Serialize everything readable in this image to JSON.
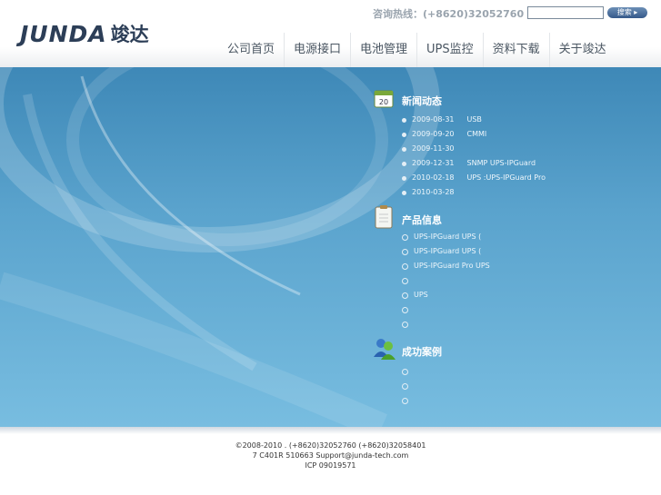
{
  "header": {
    "logo_en": "JUNDA",
    "logo_cn": "竣达",
    "hotline": "咨询热线：(+8620)32052760",
    "search_value": "",
    "search_button": "搜索 ▸"
  },
  "nav": [
    "公司首页",
    "电源接口",
    "电池管理",
    "UPS监控",
    "资料下载",
    "关于竣达"
  ],
  "news": {
    "title": "新闻动态",
    "icon_text": "20",
    "items": [
      {
        "date": "2009-08-31",
        "text": "USB"
      },
      {
        "date": "2009-09-20",
        "text": "CMMI"
      },
      {
        "date": "2009-11-30",
        "text": ""
      },
      {
        "date": "2009-12-31",
        "text": "SNMP   UPS-IPGuard"
      },
      {
        "date": "2010-02-18",
        "text": "UPS        :UPS-IPGuard Pro"
      },
      {
        "date": "2010-03-28",
        "text": ""
      }
    ]
  },
  "products": {
    "title": "产品信息",
    "items": [
      "UPS-IPGuard UPS     (",
      "UPS-IPGuard UPS     (",
      "UPS-IPGuard Pro UPS",
      "",
      " UPS",
      "",
      ""
    ]
  },
  "cases": {
    "title": "成功案例",
    "items": [
      "",
      "",
      ""
    ]
  },
  "footer": {
    "line1": "©2008-2010          .        (+8620)32052760   (+8620)32058401",
    "line2": "7    C401R     510663    Support@junda-tech.com",
    "line3": "ICP 09019571"
  },
  "colors": {
    "brand": "#2c3e57",
    "main_top": "#3e88b7",
    "main_bottom": "#78bde0",
    "search_button": "#35598a"
  }
}
